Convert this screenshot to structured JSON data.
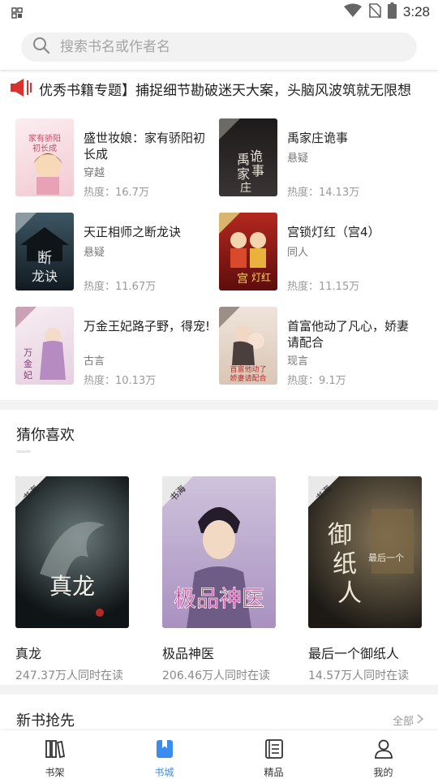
{
  "status_bar": {
    "time": "3:28"
  },
  "search": {
    "placeholder": "搜索书名或作者名"
  },
  "notice": {
    "text": "优秀书籍专题】捕捉细节勘破迷天大案，头脑风波筑就无限想"
  },
  "featured": [
    {
      "title": "盛世妆娘：家有骄阳初长成",
      "category": "穿越",
      "heat": "热度：16.7万",
      "cover_bg": "#f6dde2",
      "cover_text": "家有骄阳初长成"
    },
    {
      "title": "禹家庄诡事",
      "category": "悬疑",
      "heat": "热度：14.13万",
      "cover_bg": "#2a2626",
      "cover_text": "禹家庄诡事"
    },
    {
      "title": "天正相师之断龙诀",
      "category": "悬疑",
      "heat": "热度：11.67万",
      "cover_bg": "#24313a",
      "cover_text": "断龙诀"
    },
    {
      "title": "宫锁灯红（宫4）",
      "category": "同人",
      "heat": "热度：11.15万",
      "cover_bg": "#8c1c1a",
      "cover_text": "宫锁灯红"
    },
    {
      "title": "万金王妃路子野，得宠!",
      "category": "古言",
      "heat": "热度：10.13万",
      "cover_bg": "#efe3ea",
      "cover_text": "万金王妃路子野"
    },
    {
      "title": "首富他动了凡心，娇妻请配合",
      "category": "现言",
      "heat": "热度：9.1万",
      "cover_bg": "#e6d9cf",
      "cover_text": "首富他动了凡心娇妻请配合"
    }
  ],
  "guess": {
    "title": "猜你喜欢",
    "books": [
      {
        "title": "真龙",
        "readers": "247.37万人同时在读",
        "cover_bg": "#1f2a2e",
        "cover_text": "真龙"
      },
      {
        "title": "极品神医",
        "readers": "206.46万人同时在读",
        "cover_bg": "#b8a9c9",
        "cover_text": "极品神医"
      },
      {
        "title": "最后一个御纸人",
        "readers": "14.57万人同时在读",
        "cover_bg": "#3a352d",
        "cover_text": "御纸人"
      }
    ]
  },
  "new_books": {
    "title": "新书抢先",
    "more": "全部"
  },
  "nav": [
    {
      "label": "书架"
    },
    {
      "label": "书城"
    },
    {
      "label": "精品"
    },
    {
      "label": "我的"
    }
  ],
  "colors": {
    "accent": "#3a8cf0",
    "speaker": "#d9322e"
  }
}
